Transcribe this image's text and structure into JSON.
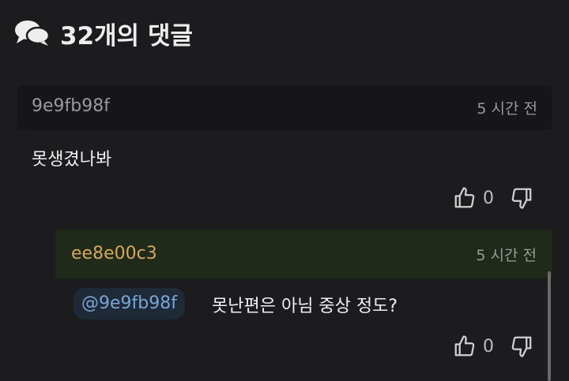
{
  "header": {
    "title": "32개의 댓글",
    "icon": "comments-icon"
  },
  "comment": {
    "author": "9e9fb98f",
    "time": "5 시간 전",
    "text": "못생겼나봐",
    "likes": "0"
  },
  "reply": {
    "author": "ee8e00c3",
    "time": "5 시간 전",
    "mention": "@9e9fb98f",
    "text": "못난편은 아님 중상 정도?",
    "likes": "0"
  },
  "colors": {
    "background": "#1c1c1e",
    "reply_header": "#1f2a1a",
    "reply_author": "#d7a75c",
    "mention_text": "#7aa4d6"
  }
}
